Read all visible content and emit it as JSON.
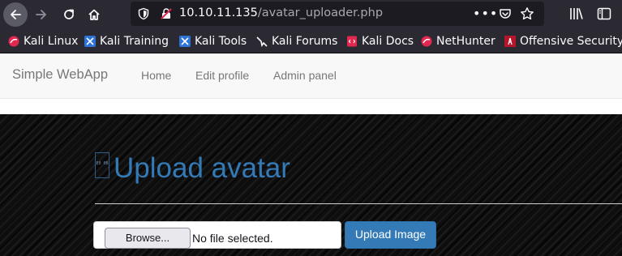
{
  "browser": {
    "url_host": "10.10.11.135",
    "url_path": "/avatar_uploader.php",
    "more_label": "•••"
  },
  "bookmarks": [
    {
      "label": "Kali Linux",
      "icon": "kali-linux-icon"
    },
    {
      "label": "Kali Training",
      "icon": "kali-training-icon"
    },
    {
      "label": "Kali Tools",
      "icon": "kali-tools-icon"
    },
    {
      "label": "Kali Forums",
      "icon": "kali-forums-icon"
    },
    {
      "label": "Kali Docs",
      "icon": "kali-docs-icon"
    },
    {
      "label": "NetHunter",
      "icon": "nethunter-icon"
    },
    {
      "label": "Offensive Security",
      "icon": "offsec-icon"
    }
  ],
  "navbar": {
    "brand": "Simple WebApp",
    "links": [
      "Home",
      "Edit profile",
      "Admin panel"
    ]
  },
  "main": {
    "title": "Upload avatar",
    "broken_image_text": "E0 0B",
    "browse_label": "Browse...",
    "no_file_label": "No file selected.",
    "upload_label": "Upload Image"
  },
  "colors": {
    "browser_chrome": "#2b2a33",
    "urlbar": "#1c1b22",
    "title_blue": "#337ab7",
    "upload_button": "#337ab7",
    "hero_background": "#0e0e0e"
  }
}
